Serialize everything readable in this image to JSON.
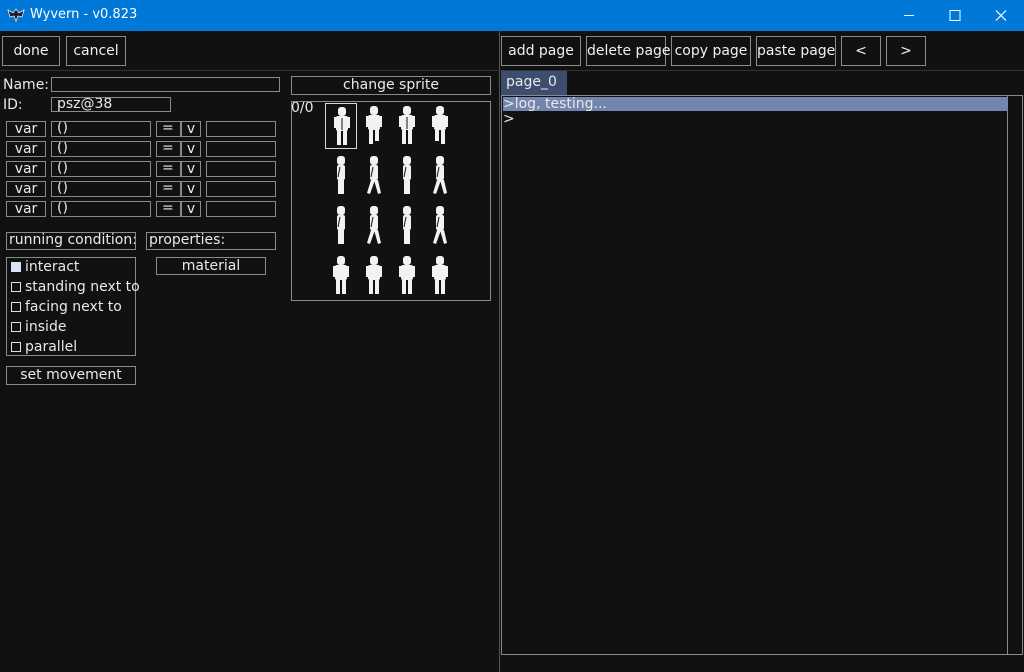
{
  "window": {
    "title": "Wyvern - v0.823",
    "icon": "wyvern-logo-icon",
    "controls": [
      "minimize-icon",
      "maximize-icon",
      "close-icon"
    ]
  },
  "toolbar": {
    "done": "done",
    "cancel": "cancel",
    "add_page": "add page",
    "delete_page": "delete page",
    "copy_page": "copy page",
    "paste_page": "paste page",
    "prev": "<",
    "next": ">"
  },
  "form": {
    "name_label": "Name:",
    "name_value": "",
    "id_label": "ID:",
    "id_value": "psz@38",
    "change_sprite": "change sprite",
    "sprite_counter": "0/0",
    "var_rows": [
      {
        "var": "var",
        "value": "()",
        "op": "=",
        "dropdown": "v",
        "target": ""
      },
      {
        "var": "var",
        "value": "()",
        "op": "=",
        "dropdown": "v",
        "target": ""
      },
      {
        "var": "var",
        "value": "()",
        "op": "=",
        "dropdown": "v",
        "target": ""
      },
      {
        "var": "var",
        "value": "()",
        "op": "=",
        "dropdown": "v",
        "target": ""
      },
      {
        "var": "var",
        "value": "()",
        "op": "=",
        "dropdown": "v",
        "target": ""
      }
    ],
    "running_condition_label": "running condition:",
    "properties_label": "properties:",
    "material": "material",
    "conditions": [
      {
        "label": "interact",
        "checked": true
      },
      {
        "label": "standing next to",
        "checked": false
      },
      {
        "label": "facing next to",
        "checked": false
      },
      {
        "label": "inside",
        "checked": false
      },
      {
        "label": "parallel",
        "checked": false
      }
    ],
    "set_movement": "set movement"
  },
  "editor": {
    "tab": "page_0",
    "lines": [
      {
        "text": ">log, testing...",
        "highlighted": true
      },
      {
        "text": ">",
        "highlighted": false
      }
    ]
  },
  "colors": {
    "titlebar": "#0078d7",
    "background": "#111111",
    "tab": "#3c4d70",
    "highlight": "#7185ae",
    "checked": "#d8e3f5"
  }
}
